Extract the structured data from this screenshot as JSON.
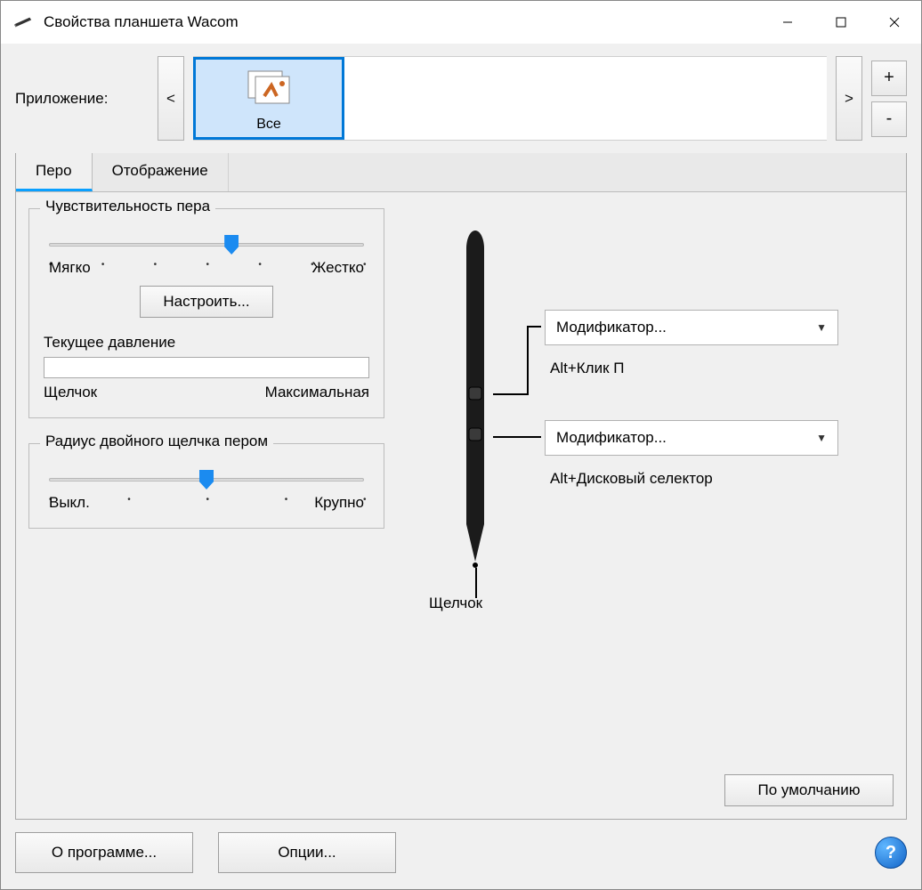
{
  "window": {
    "title": "Свойства планшета Wacom"
  },
  "app_row": {
    "label": "Приложение:",
    "prev": "<",
    "next": ">",
    "add": "+",
    "remove": "-",
    "selected_name": "Все"
  },
  "tabs": {
    "pen": "Перо",
    "mapping": "Отображение"
  },
  "pen_feel": {
    "legend": "Чувствительность пера",
    "soft": "Мягко",
    "firm": "Жестко",
    "customize": "Настроить...",
    "slider_percent": 58
  },
  "current_pressure": {
    "label": "Текущее давление",
    "click": "Щелчок",
    "max": "Максимальная"
  },
  "dblclick": {
    "legend": "Радиус двойного щелчка пером",
    "off": "Выкл.",
    "large": "Крупно",
    "slider_percent": 50
  },
  "pen": {
    "tip_label": "Щелчок",
    "button1": {
      "mode": "Модификатор...",
      "value": "Alt+Клик П"
    },
    "button2": {
      "mode": "Модификатор...",
      "value": "Alt+Дисковый селектор"
    }
  },
  "buttons": {
    "default": "По умолчанию",
    "about": "О программе...",
    "options": "Опции..."
  }
}
